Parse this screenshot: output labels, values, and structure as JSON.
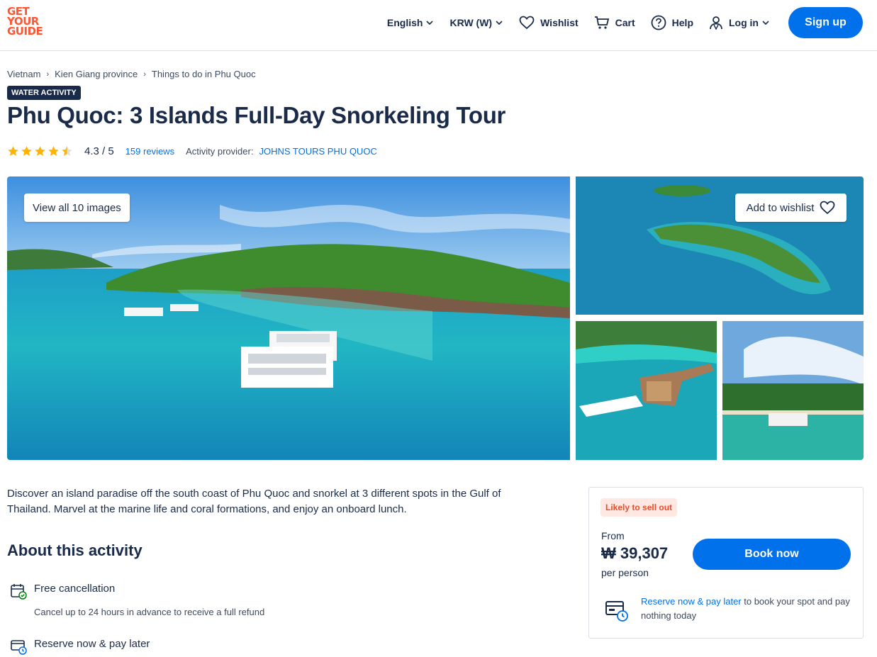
{
  "header": {
    "logo": [
      "GET",
      "YOUR",
      "GUIDE"
    ],
    "language": "English",
    "currency": "KRW (W)",
    "wishlist": "Wishlist",
    "cart": "Cart",
    "help": "Help",
    "login": "Log in",
    "signup": "Sign up"
  },
  "breadcrumb": [
    "Vietnam",
    "Kien Giang province",
    "Things to do in Phu Quoc"
  ],
  "badge": "WATER ACTIVITY",
  "title": "Phu Quoc: 3 Islands Full-Day Snorkeling Tour",
  "rating": {
    "stars": 4.5,
    "value": "4.3 / 5",
    "reviews": "159 reviews",
    "provider_label": "Activity provider:",
    "provider": "JOHNS TOURS PHU QUOC"
  },
  "gallery": {
    "view_all": "View all 10 images",
    "add_wishlist": "Add to wishlist"
  },
  "description": "Discover an island paradise off the south coast of Phu Quoc and snorkel at 3 different spots in the Gulf of Thailand. Marvel at the marine life and coral formations, and enjoy an onboard lunch.",
  "about": {
    "heading": "About this activity",
    "free_cancel_title": "Free cancellation",
    "free_cancel_sub": "Cancel up to 24 hours in advance to receive a full refund",
    "reserve_title": "Reserve now & pay later"
  },
  "booking": {
    "urgency": "Likely to sell out",
    "from": "From",
    "price": "₩ 39,307",
    "per": "per person",
    "book": "Book now",
    "reserve_link": "Reserve now & pay later",
    "reserve_rest": " to book your spot and pay nothing today"
  },
  "colors": {
    "brand": "#ff5533",
    "primary": "#0071eb",
    "text": "#1a2b49",
    "star": "#ffb400"
  }
}
